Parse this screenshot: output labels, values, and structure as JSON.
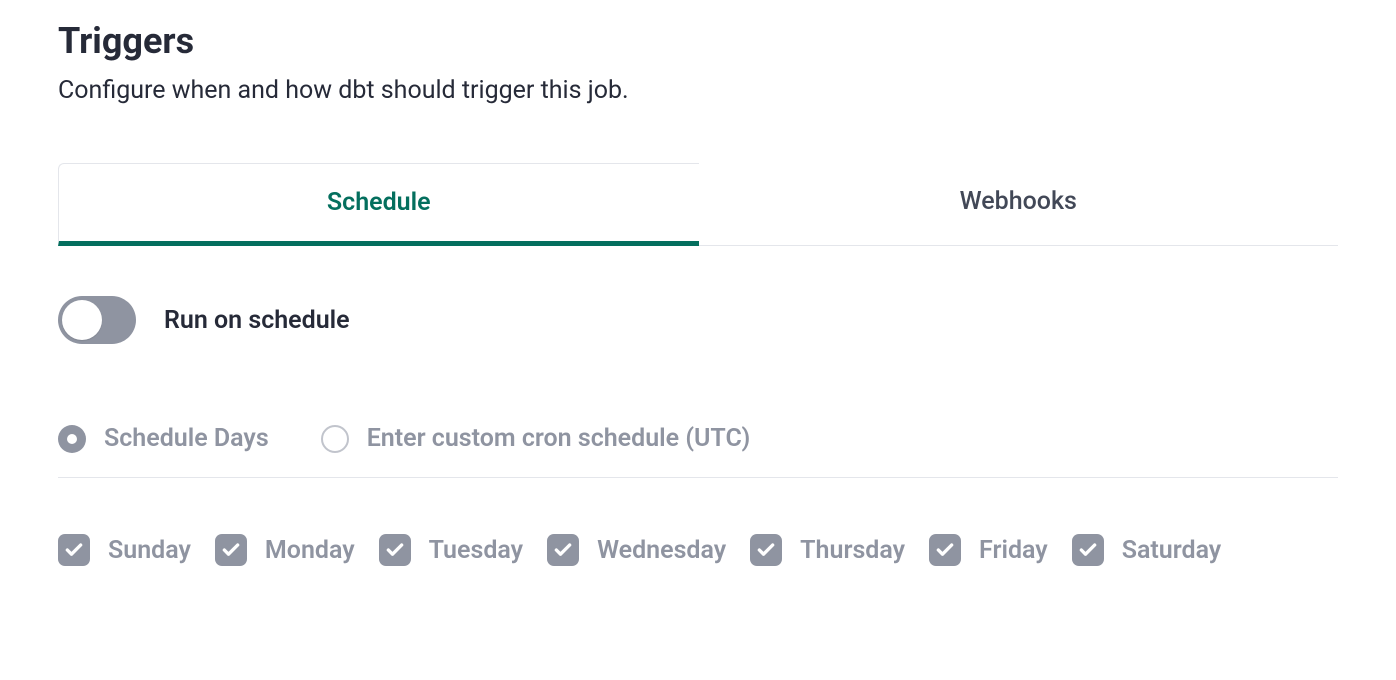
{
  "header": {
    "title": "Triggers",
    "subtitle": "Configure when and how dbt should trigger this job."
  },
  "tabs": {
    "schedule": "Schedule",
    "webhooks": "Webhooks"
  },
  "toggle": {
    "label": "Run on schedule",
    "on": false
  },
  "schedule_mode": {
    "days_label": "Schedule Days",
    "cron_label": "Enter custom cron schedule (UTC)",
    "selected": "days"
  },
  "days": [
    {
      "label": "Sunday",
      "checked": true
    },
    {
      "label": "Monday",
      "checked": true
    },
    {
      "label": "Tuesday",
      "checked": true
    },
    {
      "label": "Wednesday",
      "checked": true
    },
    {
      "label": "Thursday",
      "checked": true
    },
    {
      "label": "Friday",
      "checked": true
    },
    {
      "label": "Saturday",
      "checked": true
    }
  ]
}
